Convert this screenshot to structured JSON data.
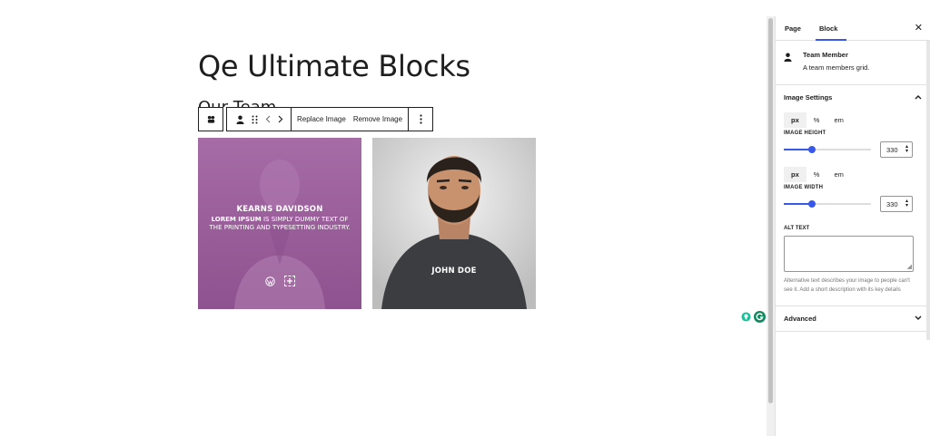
{
  "editor": {
    "page_title": "Qe Ultimate Blocks",
    "section_heading": "Our Team"
  },
  "toolbar": {
    "replace_label": "Replace Image",
    "remove_label": "Remove Image"
  },
  "team": [
    {
      "name": "KEARNS DAVIDSON",
      "desc_bold": "LOREM IPSUM",
      "desc_rest": " IS SIMPLY DUMMY TEXT OF THE PRINTING AND TYPESETTING INDUSTRY.",
      "overlay_color": "#9a5c9a",
      "social_icons": [
        "wordpress-icon",
        "plus-icon"
      ]
    },
    {
      "name": "JOHN DOE"
    }
  ],
  "sidebar": {
    "tabs": [
      "Page",
      "Block"
    ],
    "active_tab": "Block",
    "block": {
      "title": "Team Member",
      "description": "A team members grid."
    },
    "image_settings": {
      "title": "Image Settings",
      "units": [
        "px",
        "%",
        "em"
      ],
      "active_unit": "px",
      "height_label": "IMAGE HEIGHT",
      "height_value": "330",
      "height_fraction": 0.32,
      "width_label": "IMAGE WIDTH",
      "width_value": "330",
      "width_fraction": 0.32,
      "alt_label": "ALT TEXT",
      "alt_value": "",
      "alt_help": "Alternative text describes your image to people can't see it. Add a short description with its key details"
    },
    "advanced_title": "Advanced"
  },
  "colors": {
    "accent": "#3858e9",
    "text": "#1e1e1e",
    "badge_green": "#15c39a",
    "grammarly": "#0f8a5f"
  }
}
